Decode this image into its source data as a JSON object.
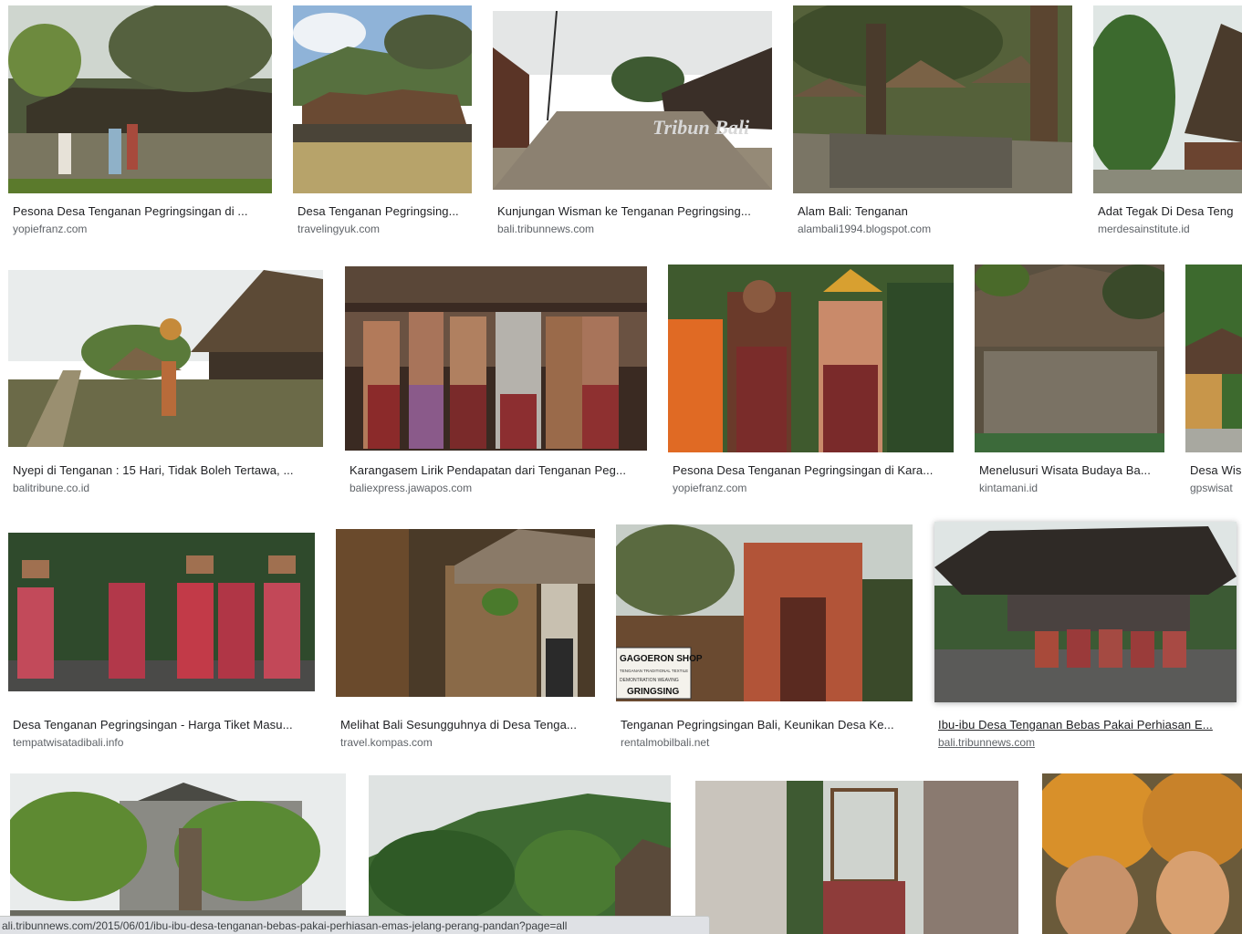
{
  "results": [
    {
      "caption": "Pesona Desa Tenganan Pegringsingan di ...",
      "source": "yopiefranz.com"
    },
    {
      "caption": "Desa Tenganan Pegringsing...",
      "source": "travelingyuk.com"
    },
    {
      "caption": "Kunjungan Wisman ke Tenganan Pegringsing...",
      "source": "bali.tribunnews.com",
      "watermark": "Tribun Bali"
    },
    {
      "caption": "Alam Bali: Tenganan",
      "source": "alambali1994.blogspot.com"
    },
    {
      "caption": "Adat Tegak Di Desa Teng",
      "source": "merdesainstitute.id"
    },
    {
      "caption": "Nyepi di Tenganan : 15 Hari, Tidak Boleh Tertawa, ...",
      "source": "balitribune.co.id"
    },
    {
      "caption": "Karangasem Lirik Pendapatan dari Tenganan Peg...",
      "source": "baliexpress.jawapos.com"
    },
    {
      "caption": "Pesona Desa Tenganan Pegringsingan di Kara...",
      "source": "yopiefranz.com"
    },
    {
      "caption": "Menelusuri Wisata Budaya Ba...",
      "source": "kintamani.id"
    },
    {
      "caption": "Desa Wis",
      "source": "gpswisat"
    },
    {
      "caption": "Desa Tenganan Pegringsingan - Harga Tiket Masu...",
      "source": "tempatwisatadibali.info"
    },
    {
      "caption": "Melihat Bali Sesungguhnya di Desa Tenga...",
      "source": "travel.kompas.com"
    },
    {
      "caption": "Tenganan Pegringsingan Bali, Keunikan Desa Ke...",
      "source": "rentalmobilbali.net",
      "sign": [
        "GAGOERON SHOP",
        "TENGANAN TRADITIONAL TEXTILE",
        "DEMONTRATION WEAVING",
        "GRINGSING"
      ]
    },
    {
      "caption": "Ibu-ibu Desa Tenganan Bebas Pakai Perhiasan E...",
      "source": "bali.tribunnews.com"
    }
  ],
  "status_url": "ali.tribunnews.com/2015/06/01/ibu-ibu-desa-tenganan-bebas-pakai-perhiasan-emas-jelang-perang-pandan?page=all",
  "colors": {
    "caption": "#202124",
    "source": "#5f6368",
    "statusbar": "#dfe1e5"
  }
}
